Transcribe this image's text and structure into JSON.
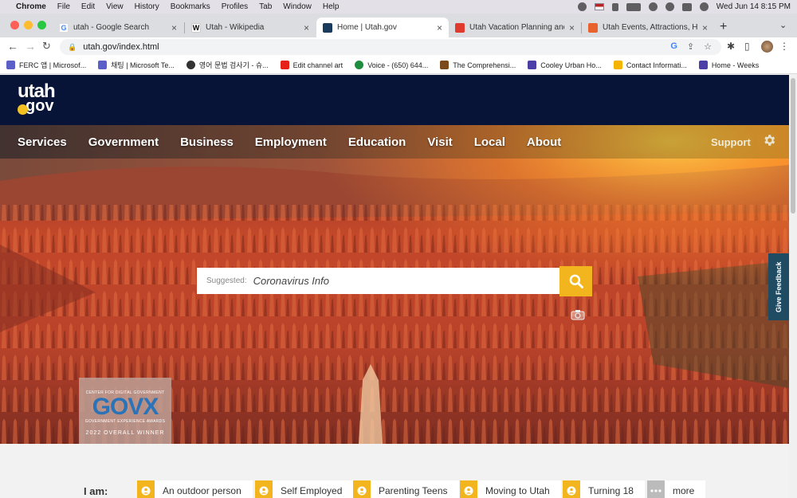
{
  "menubar": {
    "app": "Chrome",
    "items": [
      "File",
      "Edit",
      "View",
      "History",
      "Bookmarks",
      "Profiles",
      "Tab",
      "Window",
      "Help"
    ],
    "clock": "Wed Jun 14  8:15 PM"
  },
  "tabs": [
    {
      "title": "utah - Google Search",
      "icon": "google-icon"
    },
    {
      "title": "Utah - Wikipedia",
      "icon": "wikipedia-icon"
    },
    {
      "title": "Home | Utah.gov",
      "icon": "utahgov-icon"
    },
    {
      "title": "Utah Vacation Planning and Th",
      "icon": "visitutah-icon"
    },
    {
      "title": "Utah Events, Attractions, Hotel",
      "icon": "utah-events-icon"
    }
  ],
  "toolbar": {
    "url": "utah.gov/index.html"
  },
  "bookmarks": [
    {
      "label": "FERC 앱 | Microsof...",
      "color": "#5b5fc7"
    },
    {
      "label": "채팅 | Microsoft Te...",
      "color": "#5b5fc7"
    },
    {
      "label": "영어 문법 검사기 - 슈...",
      "color": "#333333"
    },
    {
      "label": "Edit channel art",
      "color": "#e62117"
    },
    {
      "label": "Voice - (650) 644...",
      "color": "#1e8e3e"
    },
    {
      "label": "The Comprehensi...",
      "color": "#7a4a1a"
    },
    {
      "label": "Cooley Urban Ho...",
      "color": "#4b3fa7"
    },
    {
      "label": "Contact Informati...",
      "color": "#f4b400"
    },
    {
      "label": "Home - Weeks",
      "color": "#4b3fa7"
    }
  ],
  "site": {
    "logo_line1": "utah",
    "logo_line2": "gov",
    "nav": [
      "Services",
      "Government",
      "Business",
      "Employment",
      "Education",
      "Visit",
      "Local",
      "About"
    ],
    "support": "Support",
    "search": {
      "suggested_label": "Suggested:",
      "value": "Coronavirus Info"
    },
    "feedback": "Give Feedback",
    "award": {
      "org": "CENTER FOR DIGITAL GOVERNMENT",
      "name": "GOVX",
      "sub": "GOVERNMENT EXPERIENCE AWARDS",
      "winner": "2022 OVERALL WINNER"
    },
    "iam_label": "I am:",
    "chips": [
      "An outdoor person",
      "Self Employed",
      "Parenting Teens",
      "Moving to Utah",
      "Turning 18",
      "more"
    ]
  },
  "colors": {
    "header_bg": "#071438",
    "accent_yellow": "#f2b51d",
    "feedback_bg": "#1f4b63"
  }
}
